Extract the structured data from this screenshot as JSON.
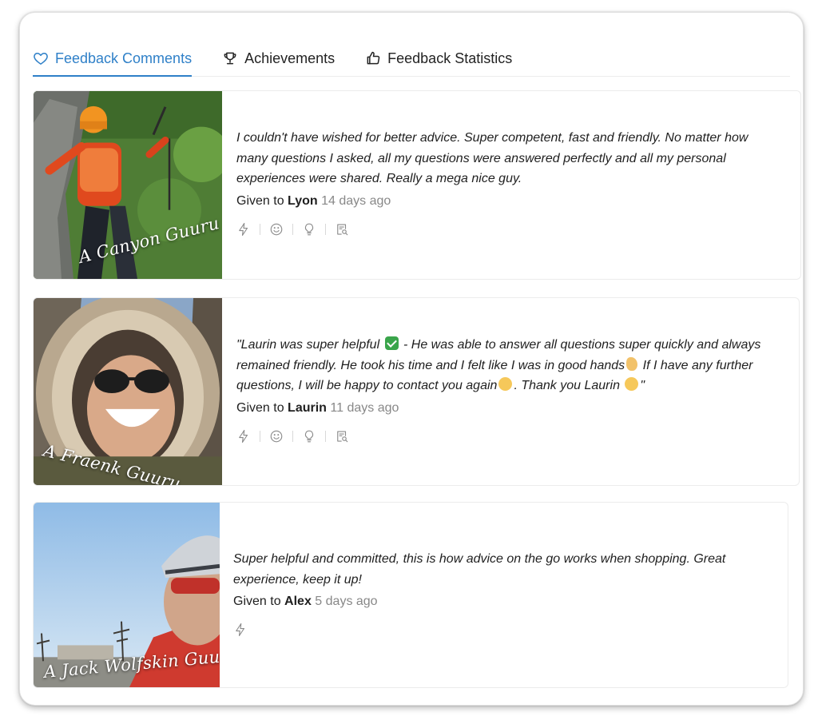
{
  "tabs": [
    {
      "label": "Feedback Comments",
      "icon": "heart-icon",
      "active": true
    },
    {
      "label": "Achievements",
      "icon": "trophy-icon",
      "active": false
    },
    {
      "label": "Feedback Statistics",
      "icon": "thumbs-up-icon",
      "active": false
    }
  ],
  "colors": {
    "accent": "#2f80c8",
    "muted_text": "#888888",
    "icon_gray": "#8a8a8a"
  },
  "feedback": [
    {
      "photo_label": "A Canyon Guuru",
      "quote": "I couldn't have wished for better advice. Super competent, fast and friendly. No matter how many questions I asked, all my questions were answered perfectly and all my personal experiences were shared. Really a mega nice guy.",
      "given_prefix": "Given to",
      "recipient": "Lyon",
      "ago": "14 days ago",
      "actions": [
        "lightning-icon",
        "smiley-icon",
        "lightbulb-icon",
        "document-search-icon"
      ]
    },
    {
      "photo_label": "A Fraenk Guuru",
      "quote_parts": [
        "\"Laurin was super helpful ",
        " - He was able to answer all questions super quickly and always remained friendly. He took his time and I felt like I was in good hands",
        " If I have any further questions, I will be happy to contact you again",
        ". Thank you Laurin ",
        "\""
      ],
      "given_prefix": "Given to",
      "recipient": "Laurin",
      "ago": "11 days ago",
      "actions": [
        "lightning-icon",
        "smiley-icon",
        "lightbulb-icon",
        "document-search-icon"
      ]
    },
    {
      "photo_label": "A Jack Wolfskin Guuru",
      "quote": "Super helpful and committed, this is how advice on the go works when shopping. Great experience, keep it up!",
      "given_prefix": "Given to",
      "recipient": "Alex",
      "ago": "5 days ago",
      "actions": [
        "lightning-icon"
      ]
    }
  ]
}
